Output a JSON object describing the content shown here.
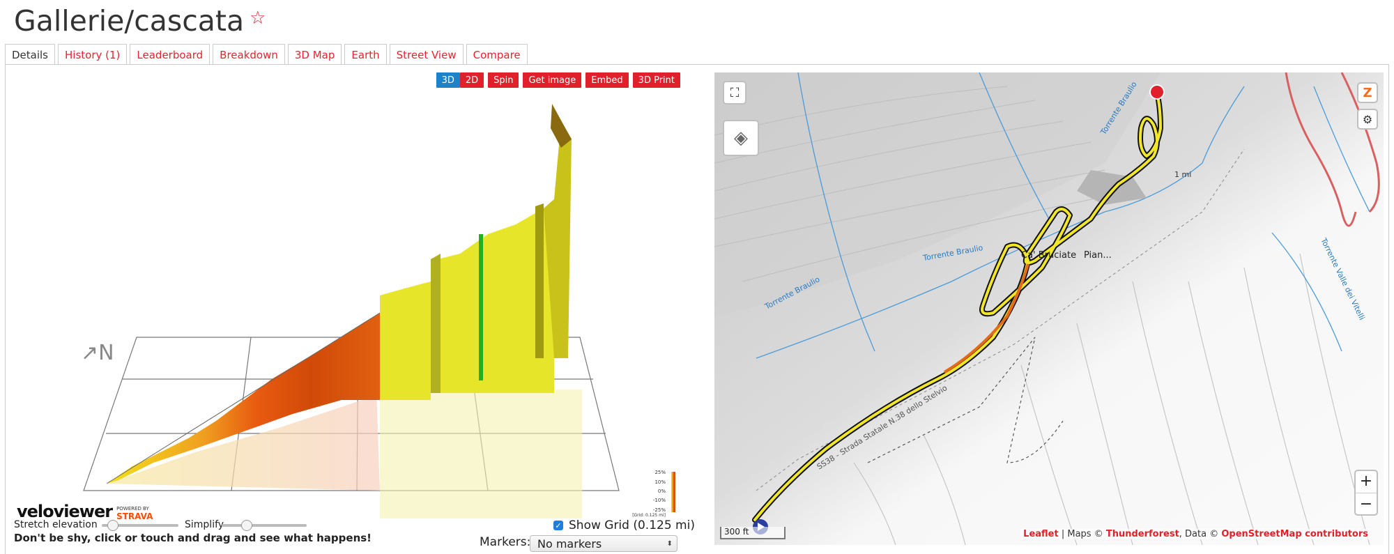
{
  "page": {
    "title": "Gallerie/cascata",
    "star": "☆"
  },
  "tabs": [
    "Details",
    "History (1)",
    "Leaderboard",
    "Breakdown",
    "3D Map",
    "Earth",
    "Street View",
    "Compare"
  ],
  "viewer": {
    "buttons": [
      "3D",
      "2D",
      "Spin",
      "Get image",
      "Embed",
      "3D Print"
    ],
    "north": "↗N",
    "logo": "veloviewer",
    "powered": "POWERED BY",
    "strava": "STRAVA",
    "legend": {
      "labels": [
        "25%",
        "10%",
        "0%",
        "-10%",
        "-25%"
      ],
      "grid_note": "[Grid: 0.125 mi]"
    },
    "stretch_label": "Stretch elevation",
    "simplify_label": "Simplify",
    "show_grid_label": "Show Grid (0.125 mi)",
    "show_grid_checked": true,
    "markers_label": "Markers:",
    "markers_value": "No markers",
    "hint": "Don't be shy, click or touch and drag and see what happens!"
  },
  "map": {
    "labels": {
      "place1": "Ca' Bruciate",
      "place2": "Pian...",
      "river1": "Torrente Braulio",
      "river2": "Torrente Braulio",
      "river3": "Torrente Braulio",
      "river4": "Torrente Valle dei Vitelli",
      "road": "SS38 - Strada Statale N.38 dello Stelvio"
    },
    "milestone": "1 mi",
    "scale": "300 ft",
    "attribution": {
      "leaflet": "Leaflet",
      "maps": " | Maps © ",
      "tf": "Thunderforest",
      "data": ", Data © ",
      "osm": "OpenStreetMap contributors"
    },
    "zoom_in": "+",
    "zoom_out": "−"
  }
}
